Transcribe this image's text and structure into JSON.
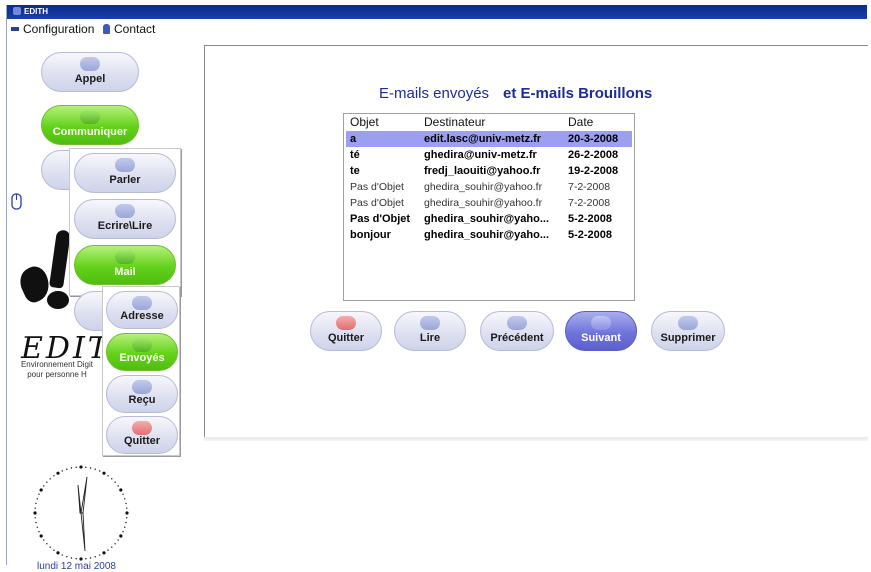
{
  "window": {
    "title": "EDITH"
  },
  "menu": [
    {
      "label": "Configuration",
      "icon": "config-icon"
    },
    {
      "label": "Contact",
      "icon": "contact-icon"
    }
  ],
  "nav": {
    "appel": "Appel",
    "communiquer": "Communiquer",
    "parler": "Parler",
    "ecrire_lire": "Ecrire\\Lire",
    "mail": "Mail",
    "adresse": "Adresse",
    "envoyes": "Envoyés",
    "recu": "Reçu",
    "quitter": "Quitter"
  },
  "logo": {
    "text": "EDIT",
    "sub_line1": "Environnement Digit",
    "sub_line2": "pour  personne  H"
  },
  "clock": {
    "date": "lundi 12 mai 2008"
  },
  "main": {
    "heading_left": "E-mails envoyés",
    "heading_right": "et  E-mails Brouillons",
    "columns": [
      "Objet",
      "Destinateur",
      "Date"
    ],
    "rows": [
      {
        "objet": "a",
        "destinateur": "edit.lasc@univ-metz.fr",
        "date": "20-3-2008",
        "selected": true,
        "bold": true
      },
      {
        "objet": "té",
        "destinateur": "ghedira@univ-metz.fr",
        "date": "26-2-2008",
        "selected": false,
        "bold": true
      },
      {
        "objet": "te",
        "destinateur": "fredj_laouiti@yahoo.fr",
        "date": "19-2-2008",
        "selected": false,
        "bold": true
      },
      {
        "objet": "Pas d'Objet",
        "destinateur": "ghedira_souhir@yahoo.fr",
        "date": "7-2-2008",
        "selected": false,
        "bold": false
      },
      {
        "objet": "Pas d'Objet",
        "destinateur": "ghedira_souhir@yahoo.fr",
        "date": "7-2-2008",
        "selected": false,
        "bold": false
      },
      {
        "objet": "Pas d'Objet",
        "destinateur": "ghedira_souhir@yaho...",
        "date": "5-2-2008",
        "selected": false,
        "bold": true
      },
      {
        "objet": "bonjour",
        "destinateur": "ghedira_souhir@yaho...",
        "date": "5-2-2008",
        "selected": false,
        "bold": true
      }
    ],
    "actions": {
      "quitter": "Quitter",
      "lire": "Lire",
      "precedent": "Précédent",
      "suivant": "Suivant",
      "supprimer": "Supprimer"
    }
  },
  "colors": {
    "accent_blue": "#1c2c9a",
    "selection": "#9c9ef0",
    "green_active": "#63d21b"
  }
}
